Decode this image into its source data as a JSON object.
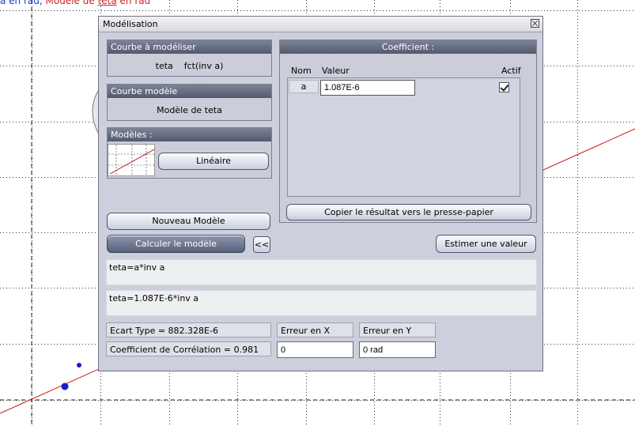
{
  "background": {
    "top_text_part1": "a en rad",
    "top_text_sep": ", ",
    "top_text_part2": "Modèle de ",
    "top_text_part3": "teta",
    "top_text_part4": " en rad"
  },
  "dialog": {
    "title": "Modélisation",
    "courbe_a_modeliser": {
      "header": "Courbe à modéliser",
      "y_var": "teta",
      "x_expr": "fct(inv a)"
    },
    "courbe_modele": {
      "header": "Courbe modèle",
      "value": "Modèle de teta"
    },
    "modeles": {
      "header": "Modèles :",
      "selected": "Linéaire"
    },
    "coefficient": {
      "header": "Coefficient :",
      "col_nom": "Nom",
      "col_valeur": "Valeur",
      "col_actif": "Actif",
      "rows": [
        {
          "nom": "a",
          "valeur": "1.087E-6",
          "actif": true
        }
      ],
      "copy_button": "Copier le résultat vers le presse-papier"
    },
    "buttons": {
      "nouveau_modele": "Nouveau Modèle",
      "calculer": "Calculer le modèle",
      "collapse": "<<",
      "estimer": "Estimer une valeur"
    },
    "equation_model": "teta=a*inv a",
    "equation_result": "teta=1.087E-6*inv a",
    "stats": {
      "ecart_type": "Ecart Type = 882.328E-6",
      "correlation": "Coefficient de Corrélation = 0.981",
      "erreur_x_label": "Erreur en X",
      "erreur_y_label": "Erreur en Y",
      "erreur_x_value": "0",
      "erreur_y_value": "0 rad"
    }
  },
  "colors": {
    "panel_header": "#5e667b",
    "dialog_bg": "#cdd0dc",
    "model_line": "#cc1111",
    "points": "#1a1acc"
  }
}
